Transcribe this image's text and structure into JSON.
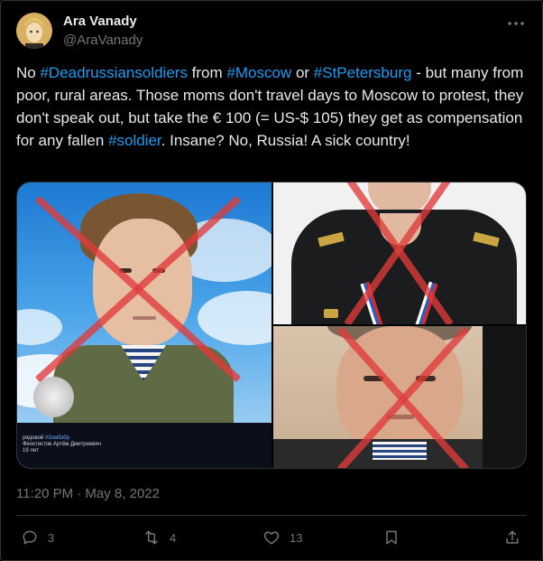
{
  "author": {
    "display_name": "Ara Vanady",
    "handle": "@AraVanady"
  },
  "tweet": {
    "segments": [
      {
        "text": "No ",
        "tag": false
      },
      {
        "text": "#Deadrussiansoldiers",
        "tag": true
      },
      {
        "text": " from ",
        "tag": false
      },
      {
        "text": "#Moscow",
        "tag": true
      },
      {
        "text": " or ",
        "tag": false
      },
      {
        "text": "#StPetersburg",
        "tag": true
      },
      {
        "text": " - but many from poor, rural areas. Those moms don't travel days to Moscow to protest, they don't speak out, but take the € 100 (= US-$ 105) they get as compensation for any fallen ",
        "tag": false
      },
      {
        "text": "#soldier",
        "tag": true
      },
      {
        "text": ". Insane? No, Russia! A sick country!",
        "tag": false
      }
    ]
  },
  "media": {
    "caption_line1_prefix": "рядовой ",
    "caption_line1_tag": "#Зомбзбр",
    "caption_line2": "Феоктистов Артём Дмитриевич",
    "caption_line3": "19 лет"
  },
  "timestamp": "11:20 PM · May 8, 2022",
  "actions": {
    "reply_count": "3",
    "retweet_count": "4",
    "like_count": "13"
  },
  "icons": {
    "more": "more-icon",
    "reply": "reply-icon",
    "retweet": "retweet-icon",
    "like": "heart-icon",
    "bookmark": "bookmark-icon",
    "share": "share-icon"
  },
  "colors": {
    "background": "#000000",
    "text": "#e7e9ea",
    "muted": "#71767b",
    "link": "#1d9bf0",
    "cross": "#e03a3a"
  }
}
